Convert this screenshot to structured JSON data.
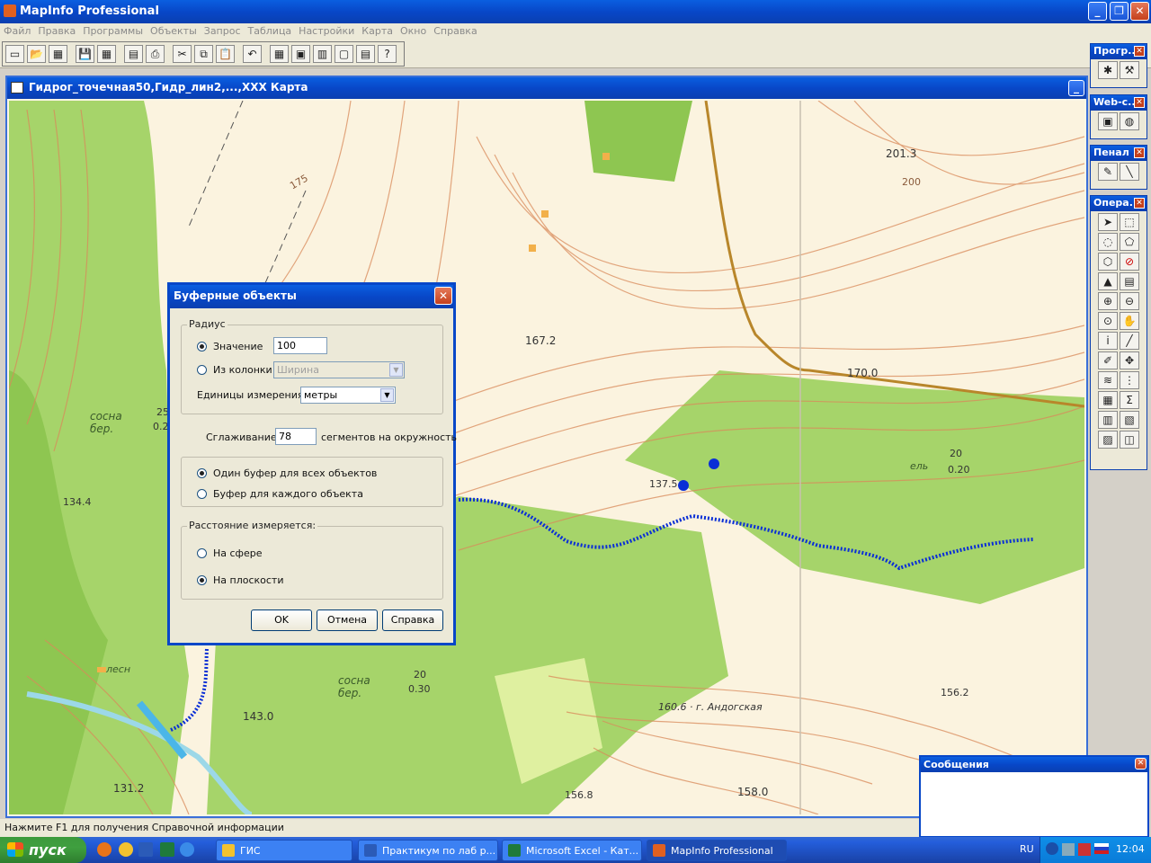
{
  "app": {
    "title": "MapInfo Professional"
  },
  "menu": [
    "Файл",
    "Правка",
    "Программы",
    "Объекты",
    "Запрос",
    "Таблица",
    "Настройки",
    "Карта",
    "Окно",
    "Справка"
  ],
  "map_window": {
    "title": "Гидрог_точечная50,Гидр_лин2,...,ХХХ Карта"
  },
  "map_labels": [
    "175",
    "201.3",
    "200",
    "167.2",
    "170.0",
    "137.5",
    "134.4",
    "143.0",
    "131.2",
    "156.8",
    "158.0",
    "160.6 · г. Андогская",
    "156.2",
    "сосна бер.",
    "сосна бер.",
    "лесн",
    "ель",
    "20",
    "0.20",
    "20",
    "0.30",
    "25",
    "0.2"
  ],
  "palettes": [
    {
      "title": "Прогр...",
      "icons": [
        "run-program-icon",
        "tool-icon"
      ]
    },
    {
      "title": "Web-с...",
      "icons": [
        "web-icon",
        "globe-icon"
      ]
    },
    {
      "title": "Пенал",
      "icons": [
        "pin-icon",
        "line-icon"
      ]
    },
    {
      "title": "Опера...",
      "icons": [
        "select-arrow-icon",
        "marquee-select-icon",
        "radius-select-icon",
        "polygon-select-icon",
        "boundary-select-icon",
        "invert-select-icon",
        "pointer-icon",
        "layer-select-icon",
        "zoom-in-icon",
        "zoom-out-icon",
        "change-view-icon",
        "grabber-icon",
        "info-icon",
        "ruler-icon",
        "label-icon",
        "drag-icon",
        "layer-control-icon",
        "legend-icon",
        "browser-icon",
        "sum-icon",
        "graph-icon",
        "layout-icon",
        "redistrict-icon",
        "clip-icon"
      ]
    }
  ],
  "dialog": {
    "title": "Буферные объекты",
    "radius_group": "Радиус",
    "value_label": "Значение",
    "value": "100",
    "column_label": "Из колонки",
    "column_value": "Ширина",
    "units_label": "Единицы измерения:",
    "units_value": "метры",
    "smoothing_label": "Сглаживание:",
    "smoothing_value": "78",
    "smoothing_suffix": "сегментов на окружность",
    "one_buffer": "Один буфер для всех объектов",
    "each_buffer": "Буфер для каждого объекта",
    "distance_group": "Расстояние измеряется:",
    "sphere": "На сфере",
    "plane": "На плоскости",
    "ok": "OK",
    "cancel": "Отмена",
    "help": "Справка"
  },
  "messages": {
    "title": "Сообщения"
  },
  "status": "Нажмите F1 для получения Справочной информации",
  "taskbar": {
    "start": "пуск",
    "buttons": [
      "ГИС",
      "Практикум по лаб р...",
      "Microsoft Excel - Кат...",
      "MapInfo Professional"
    ],
    "lang": "RU",
    "time": "12:04"
  },
  "colors": {
    "xp_blue": "#0847c8",
    "forest": "#9ccf5a",
    "contour": "#d98a5a",
    "river": "#0a2fd6"
  }
}
